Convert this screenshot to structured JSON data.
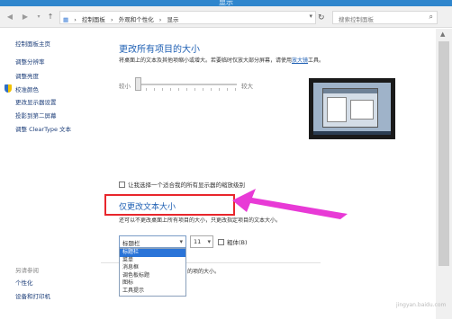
{
  "window": {
    "title": "显示"
  },
  "address": {
    "crumbs": [
      "控制面板",
      "›",
      "外观和个性化",
      "›",
      "显示"
    ],
    "search_placeholder": "搜索控制面板",
    "icons": {
      "back": "back-arrow-icon",
      "forward": "forward-arrow-icon",
      "up": "up-arrow-icon",
      "refresh": "refresh-icon",
      "search": "search-icon"
    }
  },
  "sidebar": {
    "items": [
      {
        "label": "控制面板主页"
      },
      {
        "label": "调整分辨率"
      },
      {
        "label": "调整亮度"
      },
      {
        "label": "校准颜色"
      },
      {
        "label": "更改显示器设置"
      },
      {
        "label": "投影到第二屏幕"
      },
      {
        "label": "调整 ClearType 文本"
      }
    ],
    "see_also": "另请参阅",
    "see_also_items": [
      {
        "label": "个性化"
      },
      {
        "label": "设备和打印机"
      }
    ]
  },
  "main": {
    "heading": "更改所有项目的大小",
    "description_prefix": "将桌面上的文本及其他项缩小或增大。若要临时仅放大部分屏幕，请使用",
    "magnifier_link": "放大镜",
    "description_suffix": "工具。",
    "slider_min_label": "较小",
    "slider_max_label": "较大",
    "slider_value": 0,
    "checkbox_label": "让我选择一个适合我的所有显示器的缩放级别",
    "checkbox_checked": false,
    "text_size_heading": "仅更改文本大小",
    "text_size_description": "还可以不更改桌面上所有项目的大小，只更改指定项目的文本大小。",
    "item_select_value": "标题栏",
    "font_size_value": "11",
    "bold_label": "粗体(B)",
    "bold_checked": false,
    "dropdown_options": [
      "标题栏",
      "菜单",
      "消息框",
      "调色板标题",
      "图标",
      "工具提示"
    ],
    "selected_option": "标题栏",
    "behind_text": "的项的大小。"
  },
  "annotation": {
    "highlight_color": "#e8262c",
    "arrow_color": "#e83ad6"
  },
  "watermark": "jingyan.baidu.com"
}
